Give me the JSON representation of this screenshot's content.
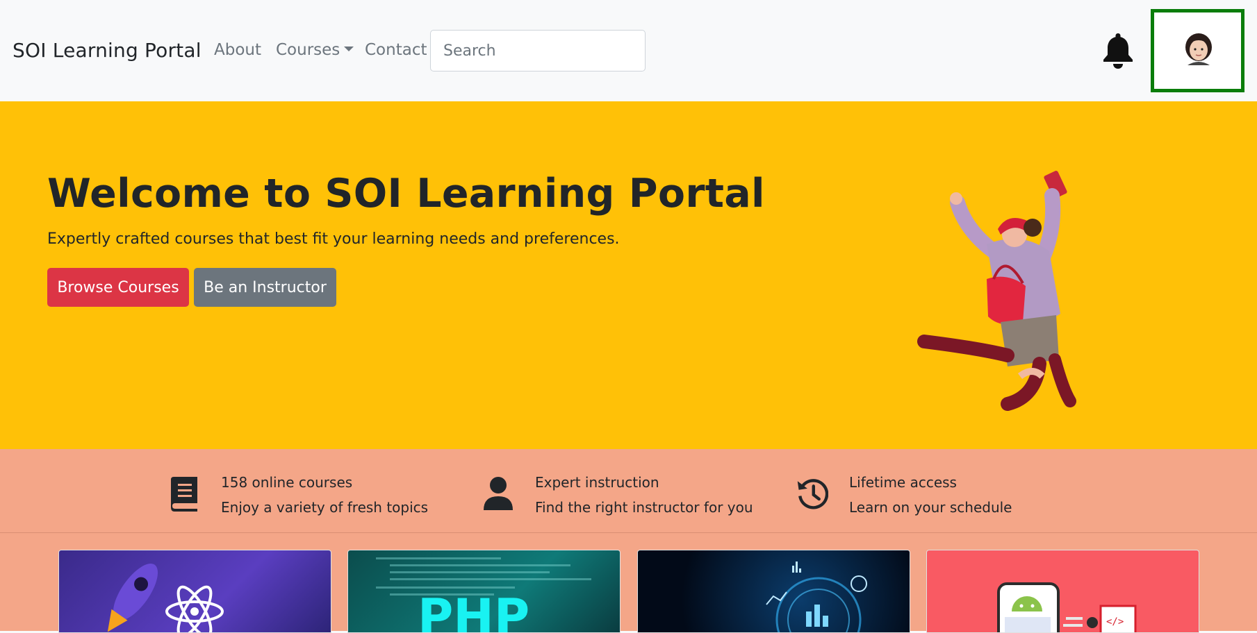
{
  "navbar": {
    "brand": "SOI Learning Portal",
    "links": [
      {
        "label": "About"
      },
      {
        "label": "Courses"
      },
      {
        "label": "Contact"
      }
    ],
    "search_placeholder": "Search",
    "notifications_icon": "bell-icon",
    "profile_icon": "user-avatar"
  },
  "hero": {
    "title": "Welcome to SOI Learning Portal",
    "subtitle": "Expertly crafted courses that best fit your learning needs and preferences.",
    "primary_button": "Browse Courses",
    "secondary_button": "Be an Instructor",
    "background_color": "#ffc107",
    "image": "jumping-woman-illustration"
  },
  "features": {
    "background_color": "#f4a688",
    "items": [
      {
        "icon": "book-icon",
        "title": "158 online courses",
        "subtitle": "Enjoy a variety of fresh topics"
      },
      {
        "icon": "user-icon",
        "title": "Expert instruction",
        "subtitle": "Find the right instructor for you"
      },
      {
        "icon": "history-icon",
        "title": "Lifetime access",
        "subtitle": "Learn on your schedule"
      }
    ]
  },
  "courses": {
    "cards": [
      {
        "image": "react-course-thumbnail",
        "visible_text": ""
      },
      {
        "image": "php-course-thumbnail",
        "visible_text": "PHP"
      },
      {
        "image": "data-analytics-course-thumbnail",
        "visible_text": ""
      },
      {
        "image": "android-course-thumbnail",
        "visible_text": "</>"
      }
    ]
  },
  "colors": {
    "danger": "#dc3545",
    "secondary": "#6c757d",
    "avatar_highlight": "#0a7d0a"
  }
}
